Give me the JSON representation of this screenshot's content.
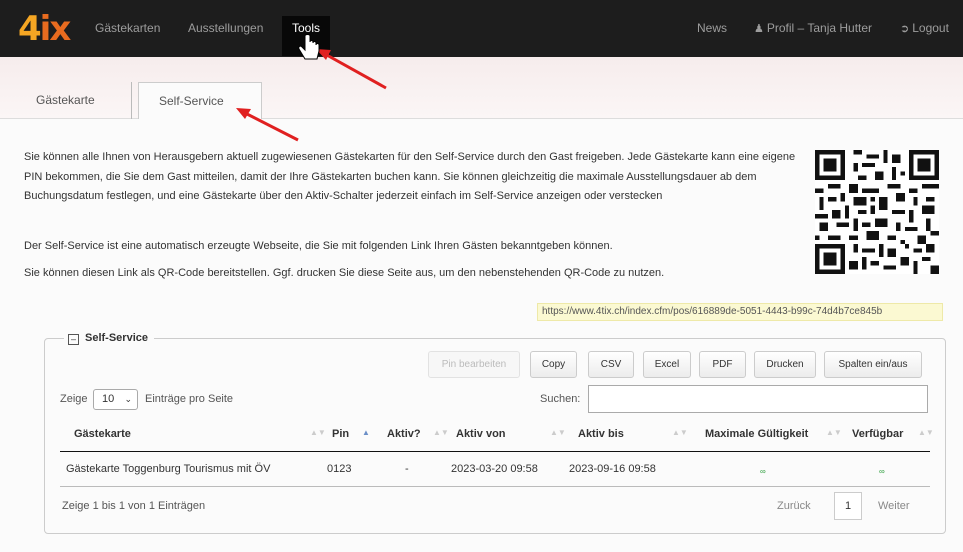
{
  "nav": {
    "logo_4": "4",
    "logo_ix": "ix",
    "gaestekarten": "Gästekarten",
    "ausstellungen": "Ausstellungen",
    "tools": "Tools",
    "news": "News",
    "profil": "Profil – Tanja Hutter",
    "logout": "Logout"
  },
  "tabs": [
    {
      "label": "Gästekarte"
    },
    {
      "label": "Self-Service",
      "active": true
    }
  ],
  "intro": {
    "p1": "Sie können alle Ihnen von Herausgebern aktuell zugewiesenen Gästekarten für den Self-Service durch den Gast freigeben. Jede Gästekarte kann eine eigene PIN bekommen, die Sie dem Gast mitteilen, damit der Ihre Gästekarten buchen kann. Sie können gleichzeitig die maximale Ausstellungsdauer ab dem Buchungsdatum festlegen, und eine Gästekarte über den Aktiv-Schalter jederzeit einfach im Self-Service anzeigen oder verstecken",
    "p2": "Der Self-Service ist eine automatisch erzeugte Webseite, die Sie mit folgenden Link Ihren Gästen bekanntgeben können.",
    "p3": "Sie können diesen Link als QR-Code bereitstellen. Ggf. drucken Sie diese Seite aus, um den nebenstehenden QR-Code zu nutzen."
  },
  "link": "https://www.4tix.ch/index.cfm/pos/616889de-5051-4443-b99c-74d4b7ce845b",
  "panel": {
    "legend_toggle": "–",
    "legend": "Self-Service",
    "buttons": {
      "pin": "Pin bearbeiten",
      "copy": "Copy",
      "csv": "CSV",
      "excel": "Excel",
      "pdf": "PDF",
      "drucken": "Drucken",
      "spalten": "Spalten ein/aus"
    },
    "zeige": "Zeige",
    "page_size": "10",
    "eintraege_pro_seite": "Einträge pro Seite",
    "suchen": "Suchen:",
    "columns": [
      "Gästekarte",
      "Pin",
      "Aktiv?",
      "Aktiv von",
      "Aktiv bis",
      "Maximale Gültigkeit",
      "Verfügbar"
    ],
    "rows": [
      [
        "Gästekarte Toggenburg Tourismus mit ÖV",
        "0123",
        "-",
        "2023-03-20 09:58",
        "2023-09-16 09:58",
        "∞",
        "∞"
      ]
    ],
    "info": "Zeige 1 bis 1 von 1 Einträgen",
    "zurueck": "Zurück",
    "current_page": "1",
    "weiter": "Weiter"
  },
  "colors": {
    "navbar": "#1d1d1d",
    "logo_orange": "#f5a623",
    "annotation_arrow": "#e02020",
    "link_box": "#fbf9d2"
  }
}
